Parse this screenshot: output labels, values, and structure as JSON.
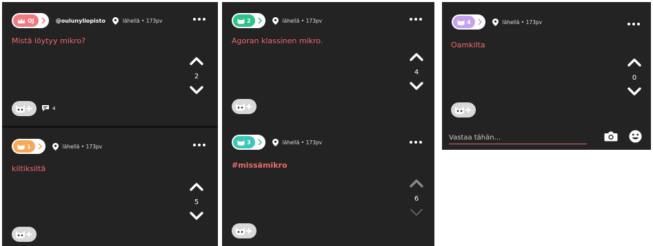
{
  "colors": {
    "background": "#232323",
    "accent": "#ee6a6a",
    "badge_red": "#f07a82",
    "badge_orange": "#f9a85a",
    "badge_green": "#2ec38a",
    "badge_teal": "#3cc6b4",
    "badge_purple": "#c5a1f0"
  },
  "panels": [
    {
      "cards": [
        {
          "badge": {
            "icon": "crown-icon",
            "label": "OJ",
            "color": "#f07a82"
          },
          "username": "@oulunyliopisto",
          "location": "lähellä • 173pv",
          "text": "Mistä löytyy mikro?",
          "votes": "2",
          "comment_count": "4"
        },
        {
          "badge": {
            "icon": "cat-icon",
            "label": "1",
            "color": "#f9a85a"
          },
          "location": "lähellä • 173pv",
          "text": "kiltiksiltä",
          "votes": "5"
        }
      ]
    },
    {
      "cards": [
        {
          "badge": {
            "icon": "cat-icon",
            "label": "2",
            "color": "#2ec38a"
          },
          "location": "lähellä • 173pv",
          "text": "Agoran klassinen mikro.",
          "votes": "4"
        },
        {
          "badge": {
            "icon": "cat-icon",
            "label": "3",
            "color": "#3cc6b4"
          },
          "location": "lähellä • 173pv",
          "text": "#missämikro",
          "votes": "6"
        }
      ]
    },
    {
      "cards": [
        {
          "badge": {
            "icon": "cat-icon",
            "label": "4",
            "color": "#c5a1f0"
          },
          "location": "lähellä • 173pv",
          "text": "Oamkilta",
          "votes": "0"
        }
      ],
      "reply": {
        "placeholder": "Vastaa tähän..."
      }
    }
  ]
}
